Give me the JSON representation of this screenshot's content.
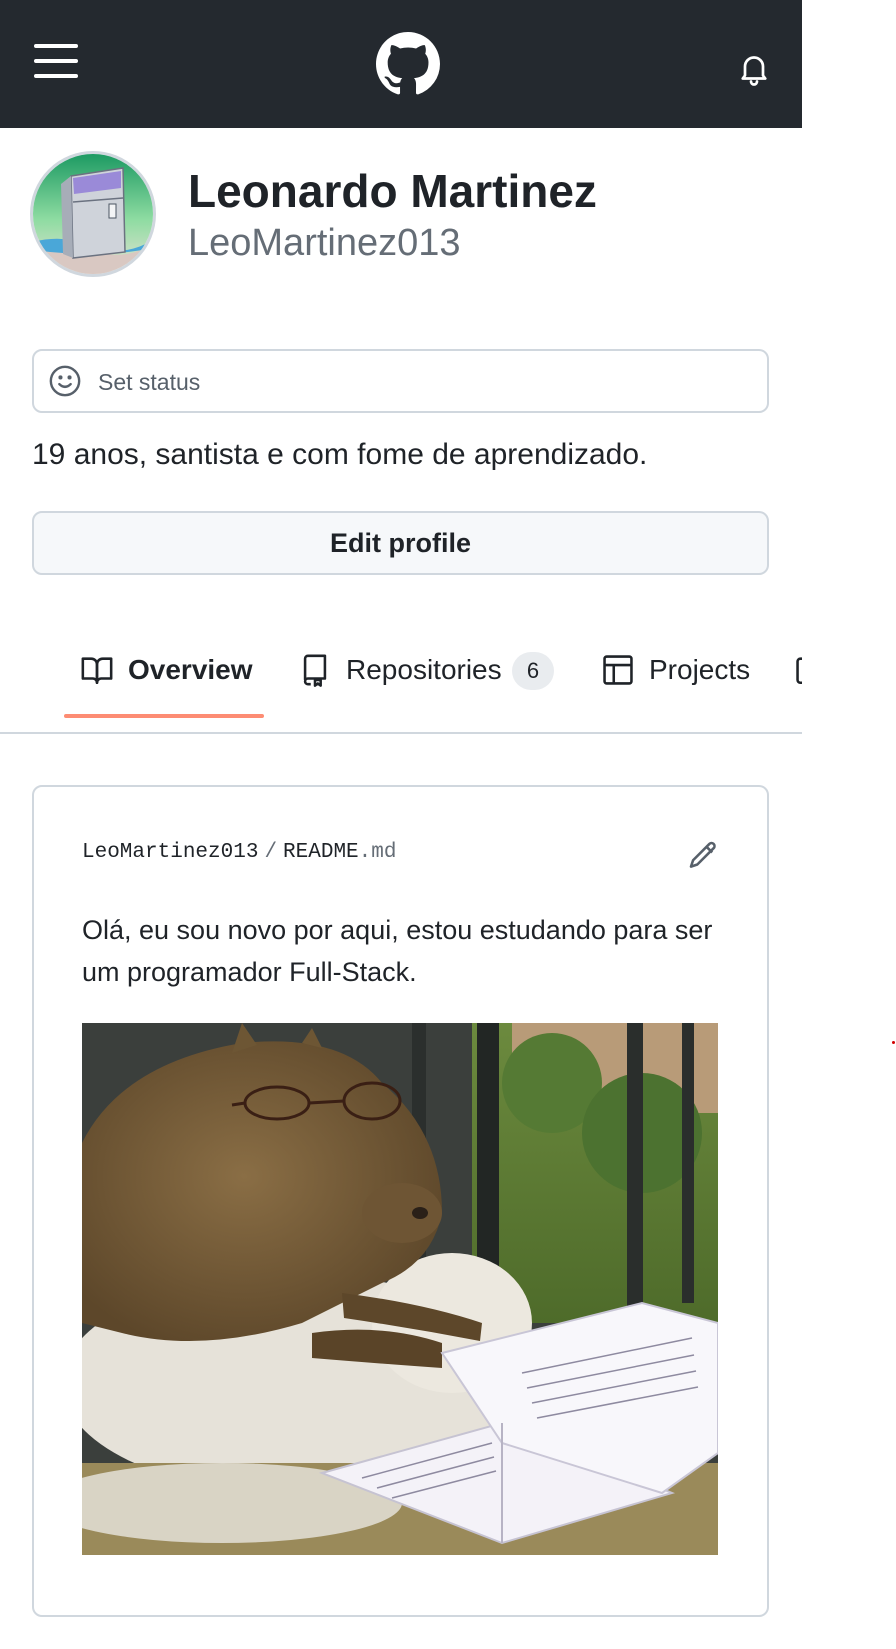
{
  "header": {
    "menu_icon": "hamburger-menu-icon",
    "logo_icon": "github-logo-icon",
    "notification_icon": "bell-icon"
  },
  "profile": {
    "name": "Leonardo Martinez",
    "login": "LeoMartinez013",
    "avatar_icon": "refrigerator-avatar-image",
    "status_placeholder": "Set status",
    "bio": "19 anos, santista e com fome de aprendizado.",
    "edit_label": "Edit profile"
  },
  "tabs": [
    {
      "label": "Overview",
      "icon": "book-icon",
      "selected": true
    },
    {
      "label": "Repositories",
      "icon": "repo-icon",
      "count": "6"
    },
    {
      "label": "Projects",
      "icon": "table-icon"
    }
  ],
  "readme": {
    "owner": "LeoMartinez013",
    "separator": "/",
    "file_base": "README",
    "file_ext": ".md",
    "text": "Olá, eu sou novo por aqui, estou estudando para ser um programador Full-Stack.",
    "image_icon": "capybara-reading-photo"
  },
  "colors": {
    "header_bg": "#24292f",
    "tab_underline": "#fd8c73",
    "border": "#d0d7de",
    "muted_text": "#656d76"
  }
}
